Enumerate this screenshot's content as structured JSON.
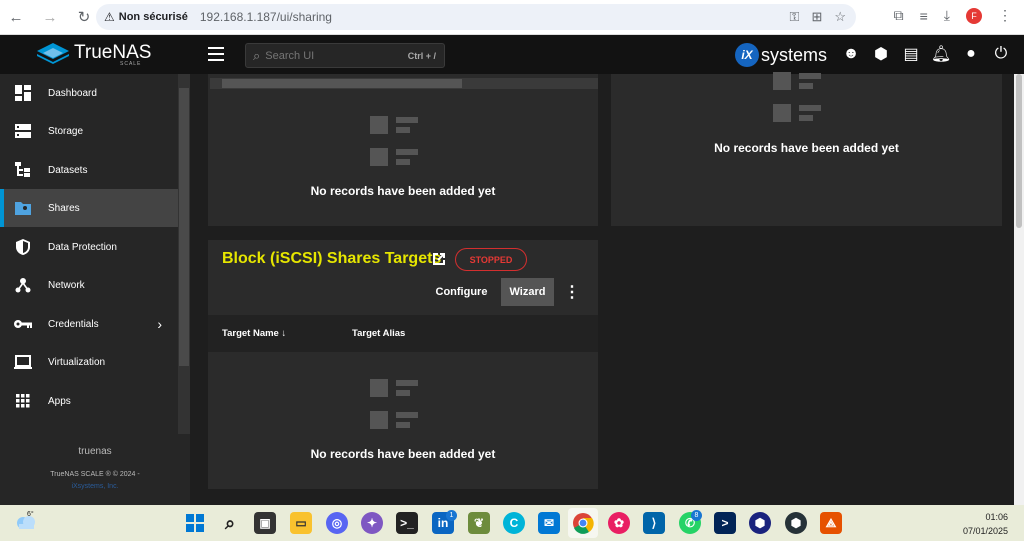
{
  "browser": {
    "security_label": "Non sécurisé",
    "url": "192.168.1.187/ui/sharing",
    "profile_initial": "F"
  },
  "app": {
    "logo_text": "TrueNAS",
    "logo_sub": "SCALE",
    "vendor": "systems",
    "vendor_badge": "iX",
    "search": {
      "placeholder": "Search UI",
      "shortcut": "Ctrl + /"
    }
  },
  "sidebar": {
    "items": [
      {
        "label": "Dashboard",
        "icon": "dashboard-icon"
      },
      {
        "label": "Storage",
        "icon": "storage-icon"
      },
      {
        "label": "Datasets",
        "icon": "datasets-icon"
      },
      {
        "label": "Shares",
        "icon": "shares-icon",
        "active": true
      },
      {
        "label": "Data Protection",
        "icon": "shield-icon"
      },
      {
        "label": "Network",
        "icon": "network-icon"
      },
      {
        "label": "Credentials",
        "icon": "key-icon",
        "has_children": true
      },
      {
        "label": "Virtualization",
        "icon": "laptop-icon"
      },
      {
        "label": "Apps",
        "icon": "apps-grid-icon"
      }
    ],
    "hostname": "truenas",
    "copyright": "TrueNAS SCALE ® © 2024 -",
    "company": "iXsystems, Inc."
  },
  "cards": {
    "top_left_empty": "No records have been added yet",
    "top_right_empty": "No records have been added yet",
    "iscsi": {
      "title": "Block (iSCSI) Shares Targets",
      "status": "STOPPED",
      "configure_label": "Configure",
      "wizard_label": "Wizard",
      "columns": [
        "Target Name",
        "Target Alias"
      ],
      "sort_indicator": "↓",
      "empty": "No records have been added yet"
    }
  },
  "colors": {
    "accent": "#0095d5",
    "title": "#e6e600",
    "stopped": "#e53935"
  },
  "taskbar": {
    "weather_temp": "6°",
    "linkedin_badge": "1",
    "whatsapp_badge": "8",
    "time": "01:06",
    "date": "07/01/2025"
  }
}
